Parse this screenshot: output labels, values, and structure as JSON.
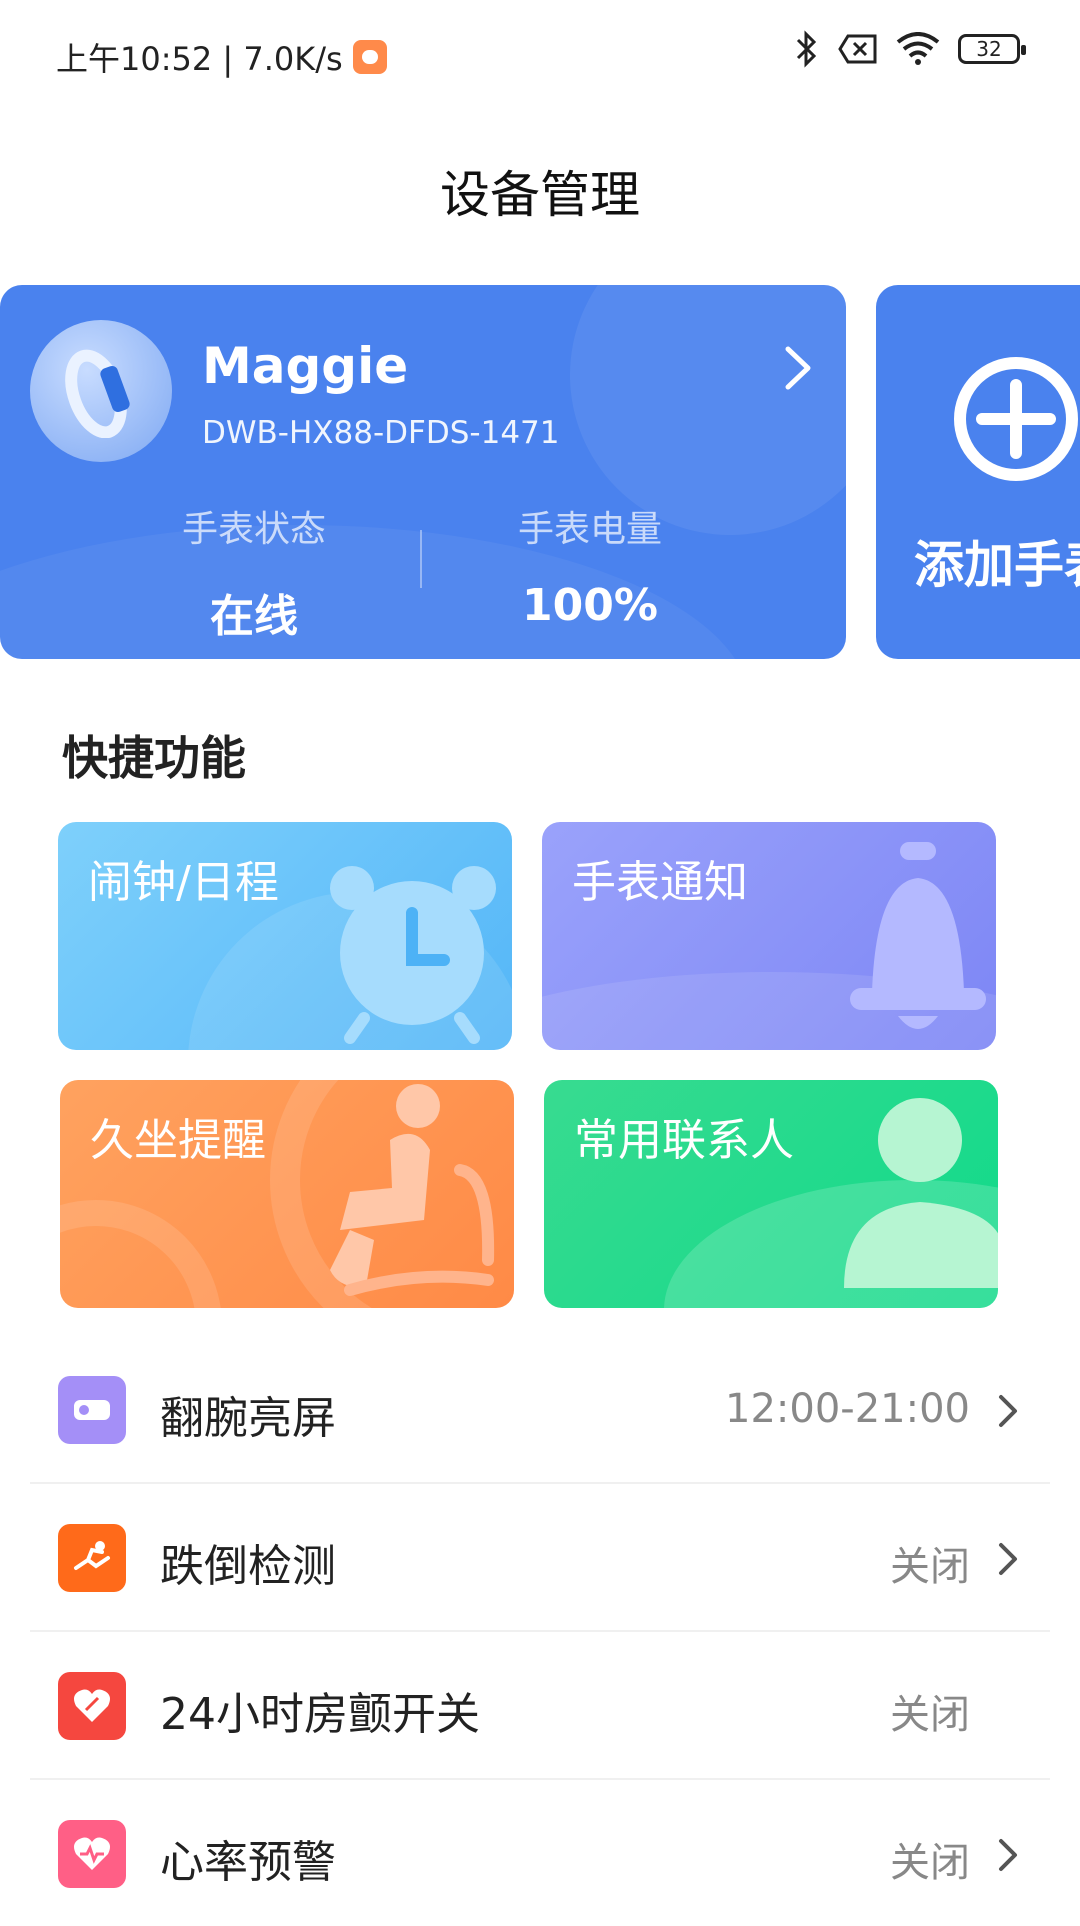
{
  "status_bar": {
    "time_speed": "上午10:52 | 7.0K/s",
    "battery": "32"
  },
  "header": {
    "title": "设备管理"
  },
  "device": {
    "name": "Maggie",
    "serial": "DWB-HX88-DFDS-1471",
    "status_label": "手表状态",
    "status_value": "在线",
    "battery_label": "手表电量",
    "battery_value": "100%"
  },
  "add_card": {
    "label": "添加手表"
  },
  "quick": {
    "title": "快捷功能",
    "tiles": [
      {
        "label": "闹钟/日程",
        "icon": "alarm-clock-icon"
      },
      {
        "label": "手表通知",
        "icon": "bell-icon"
      },
      {
        "label": "久坐提醒",
        "icon": "sitting-person-icon"
      },
      {
        "label": "常用联系人",
        "icon": "contact-person-icon"
      }
    ]
  },
  "settings": [
    {
      "label": "翻腕亮屏",
      "value": "12:00-21:00",
      "icon": "wrist-raise-icon",
      "color": "#9d8cf6",
      "chevron": true
    },
    {
      "label": "跌倒检测",
      "value": "关闭",
      "icon": "fall-detect-icon",
      "color": "#ff6a1a",
      "chevron": true
    },
    {
      "label": "24小时房颤开关",
      "value": "关闭",
      "icon": "afib-heart-icon",
      "color": "#f5473f",
      "chevron": false
    },
    {
      "label": "心率预警",
      "value": "关闭",
      "icon": "heart-rate-icon",
      "color": "#ff5f86",
      "chevron": true
    }
  ]
}
